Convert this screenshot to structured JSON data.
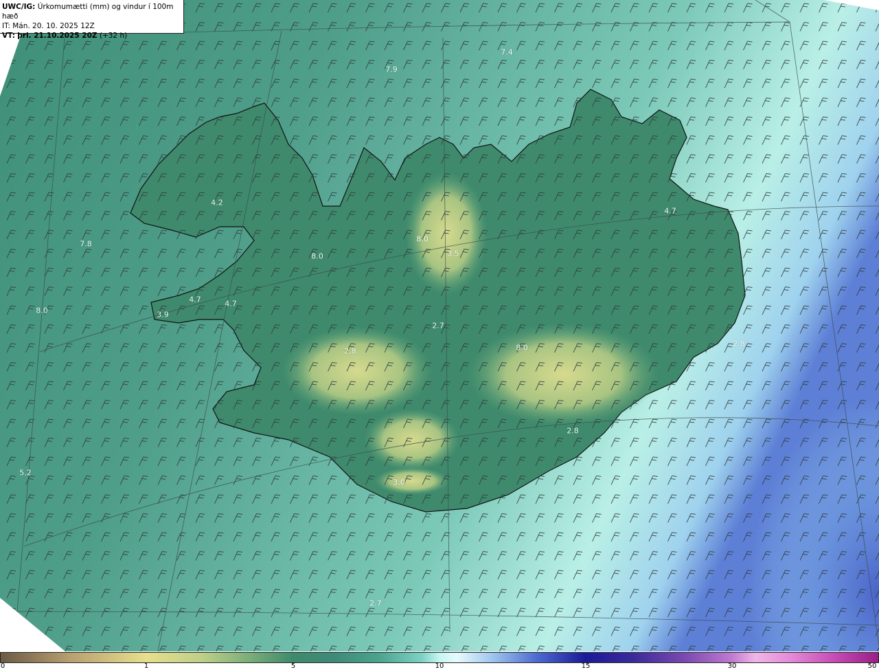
{
  "header": {
    "product": "UWC/IG:",
    "description": "Úrkomumætti (mm) og vindur í 100m hæð",
    "init_time": "IT: Mán. 20. 10. 2025 12Z",
    "valid_prefix": "VT:",
    "valid_time": "þri. 21.10.2025 20Z",
    "lead_time": "(+32 h)"
  },
  "value_labels": [
    "7.4",
    "7.9",
    "4.2",
    "4.7",
    "7.8",
    "8.0",
    "3.5",
    "8.0",
    "4.7",
    "4.7",
    "3.9",
    "8.0",
    "2.7",
    "2.8",
    "2.8",
    "8.0",
    "2.8",
    "5.2",
    "3.0",
    "2.7"
  ],
  "colorbar": {
    "ticks": [
      "0",
      "1",
      "5",
      "10",
      "15",
      "30",
      "50"
    ]
  },
  "colors": {
    "ocean": "#4f9e8a",
    "land_low": "#3f8a6c",
    "land_dry": "#bdcf88",
    "wet_east": "#c6f6ef",
    "very_wet": "#4f6cd0",
    "coastline": "#111111",
    "barb": "#2b3b3b"
  }
}
